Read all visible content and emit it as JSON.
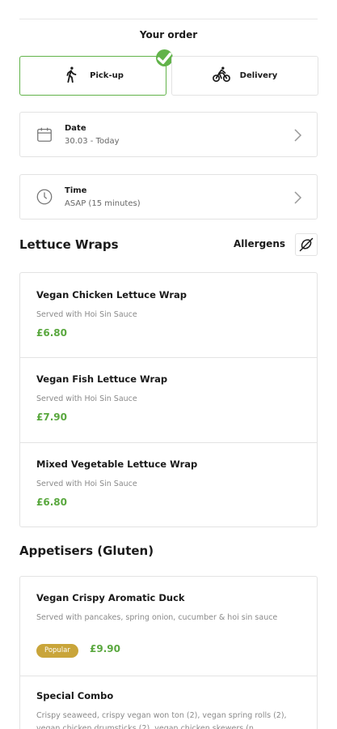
{
  "order": {
    "title": "Your order",
    "modes": [
      {
        "label": "Pick-up",
        "icon": "walking-person-icon",
        "selected": true
      },
      {
        "label": "Delivery",
        "icon": "bicycle-icon",
        "selected": false
      }
    ],
    "date": {
      "label": "Date",
      "value": "30.03 - Today",
      "icon": "calendar-icon"
    },
    "time": {
      "label": "Time",
      "value": "ASAP (15 minutes)",
      "icon": "clock-icon"
    }
  },
  "allergens": {
    "label": "Allergens",
    "icon": "allergen-icon"
  },
  "sections": [
    {
      "title": "Lettuce Wraps",
      "items": [
        {
          "name": "Vegan Chicken Lettuce Wrap",
          "description": "Served with Hoi Sin Sauce",
          "price": "£6.80"
        },
        {
          "name": "Vegan Fish Lettuce Wrap",
          "description": "Served with Hoi Sin Sauce",
          "price": "£7.90"
        },
        {
          "name": "Mixed Vegetable Lettuce Wrap",
          "description": "Served with Hoi Sin Sauce",
          "price": "£6.80"
        }
      ]
    },
    {
      "title": "Appetisers (Gluten)",
      "items": [
        {
          "name": "Vegan Crispy Aromatic Duck",
          "description": "Served with pancakes, spring onion, cucumber & hoi sin sauce",
          "badge": "Popular",
          "price": "£9.90"
        },
        {
          "name": "Special Combo",
          "description": "Crispy seaweed, crispy vegan won ton (2), vegan spring rolls (2), vegan chicken drumsticks (2), vegan chicken skewers (n"
        }
      ]
    }
  ],
  "colors": {
    "accent_green": "#62b34a",
    "price_green": "#5aa83f",
    "badge_gold": "#c9a53a",
    "border": "#e3e3e3"
  }
}
